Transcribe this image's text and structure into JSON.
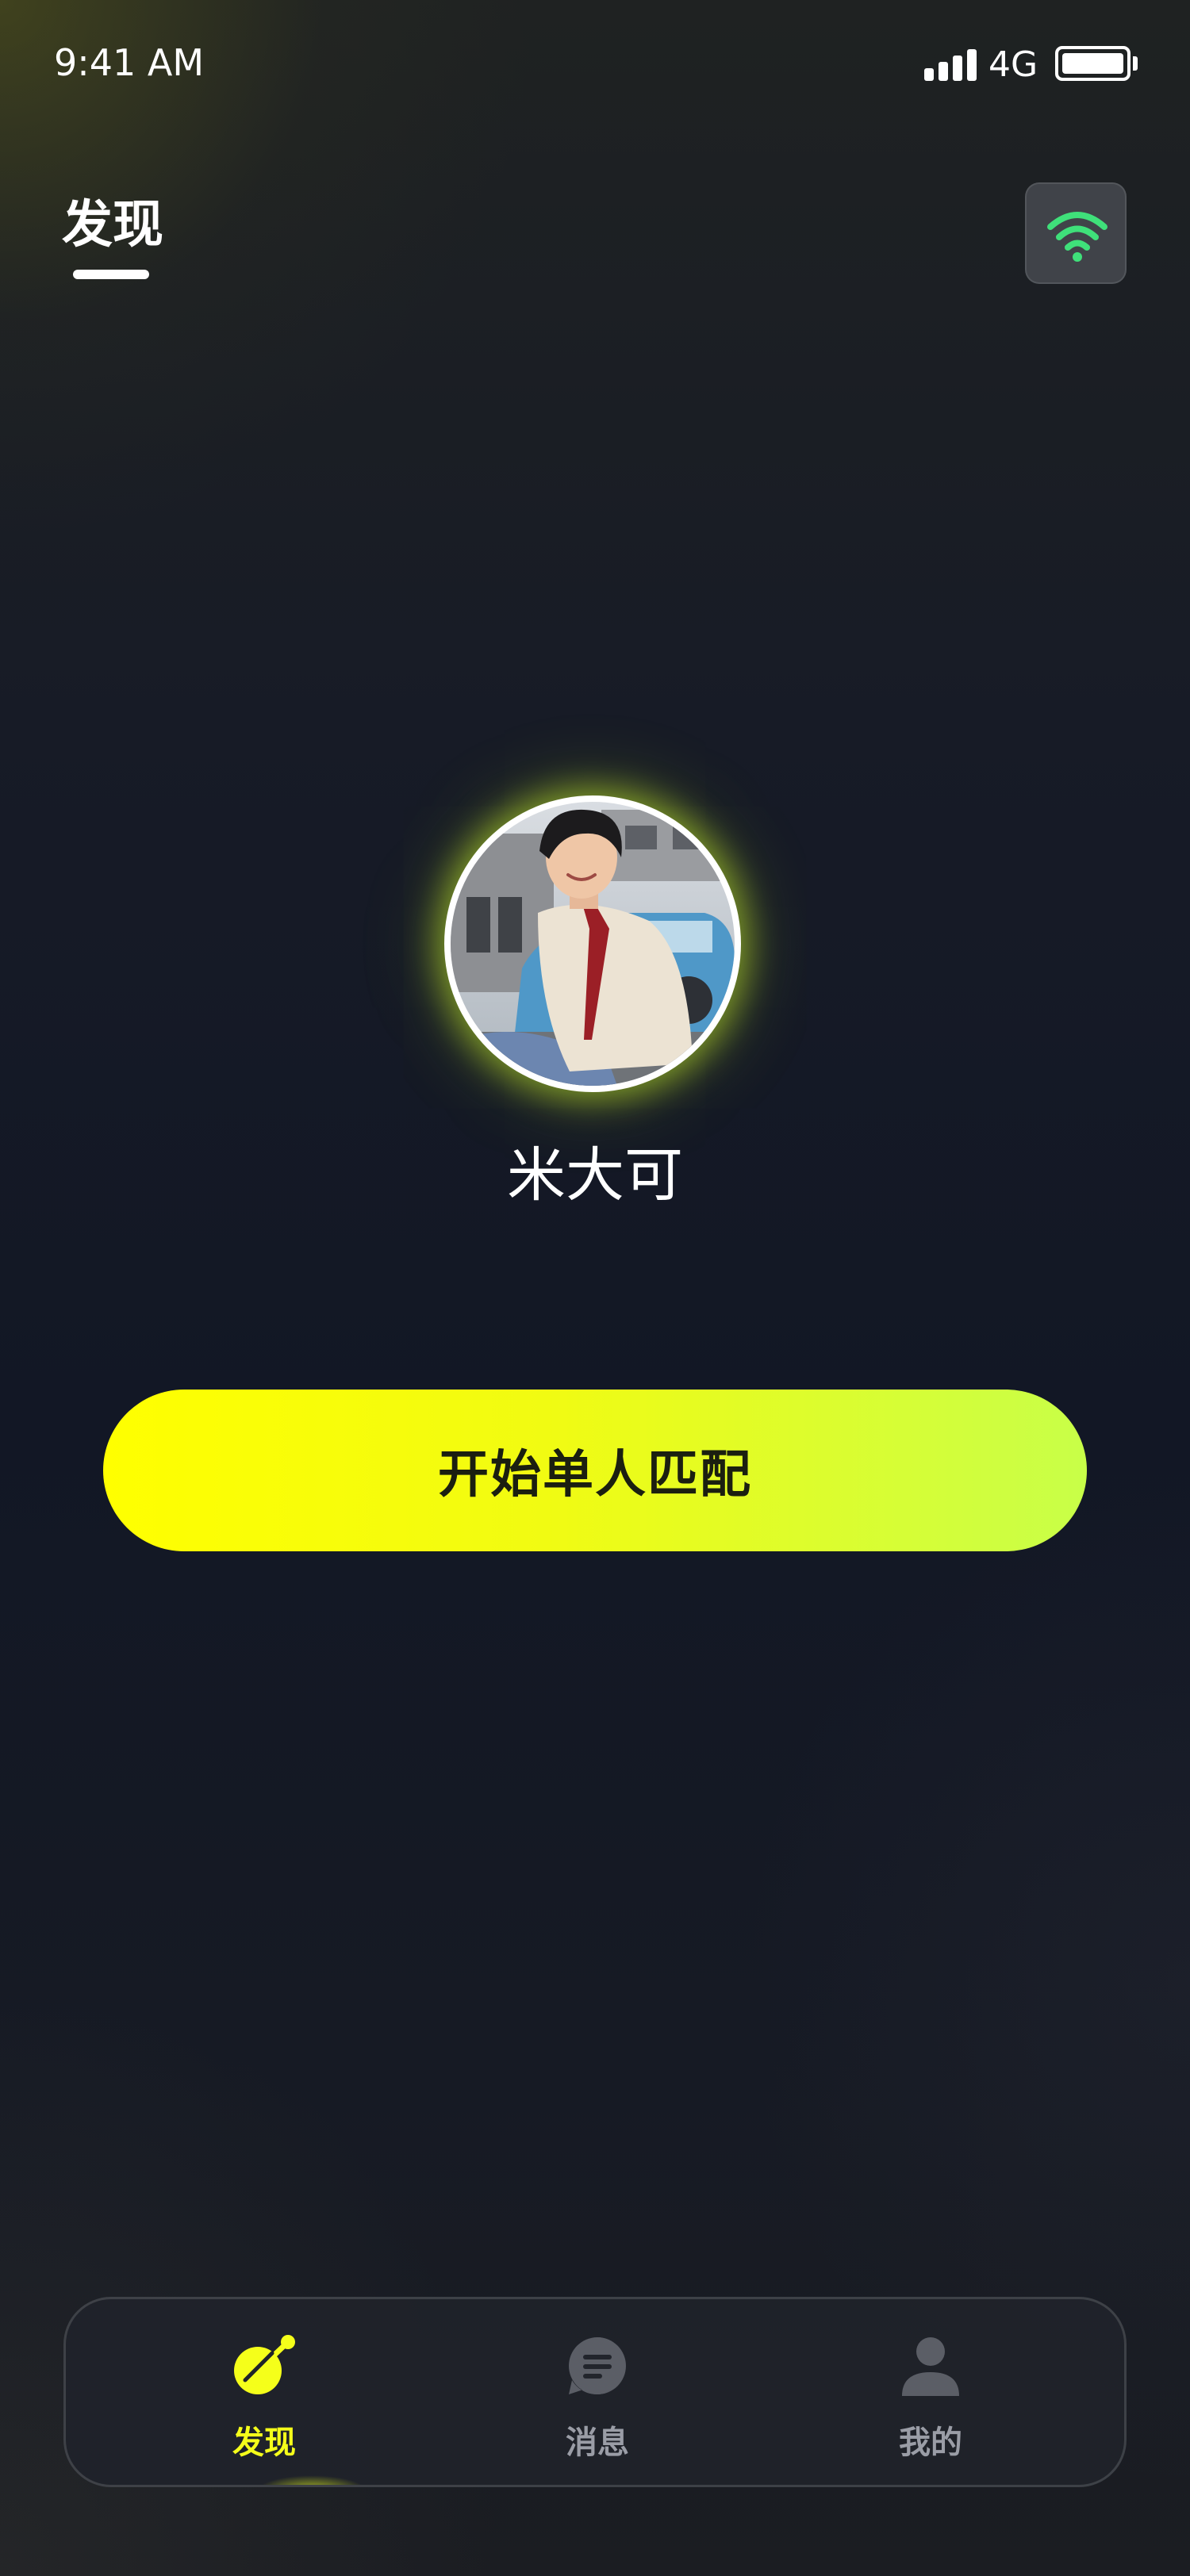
{
  "status_bar": {
    "time": "9:41 AM",
    "network": "4G"
  },
  "header": {
    "title": "发现",
    "wifi_icon": "wifi-icon"
  },
  "profile": {
    "name": "米大可",
    "avatar": "user-avatar-photo"
  },
  "actions": {
    "match_button_label": "开始单人匹配"
  },
  "tab_bar": {
    "tabs": [
      {
        "label": "发现",
        "icon": "radar-dish-icon",
        "active": true
      },
      {
        "label": "消息",
        "icon": "message-bubble-icon",
        "active": false
      },
      {
        "label": "我的",
        "icon": "person-icon",
        "active": false
      }
    ]
  },
  "colors": {
    "accent": "#F5FF1A",
    "accent_gradient_end": "#C8FF48",
    "wifi_green": "#3FE07A",
    "tab_inactive": "#9A9DA6",
    "background": "#141824"
  }
}
